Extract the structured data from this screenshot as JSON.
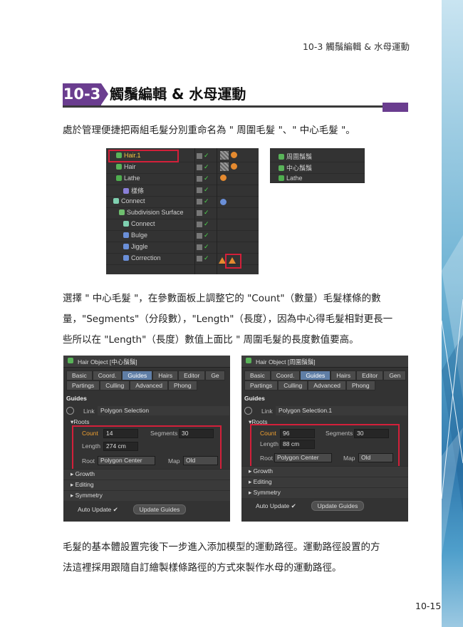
{
  "header": "10-3 觸鬚編輯 & 水母運動",
  "title": {
    "chapter": "10-3",
    "text": "觸鬚編輯 & 水母運動"
  },
  "para1": "處於管理便捷把兩組毛髮分別重命名為 \" 周圍毛髮 \"、\" 中心毛髮 \"。",
  "object_manager": {
    "rows": [
      "Hair.1",
      "Hair",
      "Lathe",
      "樣條",
      "Connect",
      "Subdivision Surface",
      "Connect",
      "Bulge",
      "Jiggle",
      "Correction"
    ]
  },
  "object_manager_small": {
    "rows": [
      "周圍鬚鬚",
      "中心鬚鬚",
      "Lathe"
    ]
  },
  "para2": [
    "選擇 \" 中心毛髮 \"，在參數面板上調整它的 \"Count\"（數量）毛髮樣條的數",
    "量，\"Segments\"（分段數），\"Length\"（長度），因為中心得毛髮相對更長一",
    "些所以在 \"Length\"（長度）數值上面比 \" 周圍毛髮的長度數值要高。"
  ],
  "panel_left": {
    "title": "Hair Object [中心鬚鬚]",
    "tabs_row1": [
      "Basic",
      "Coord.",
      "Guides",
      "Hairs",
      "Editor",
      "Ge"
    ],
    "tabs_row2": [
      "Partings",
      "Culling",
      "Advanced",
      "Phong"
    ],
    "section": "Guides",
    "link_label": "Link",
    "link_value": "Polygon Selection",
    "roots": "▾Roots",
    "count_label": "Count",
    "count_value": "14",
    "segments_label": "Segments",
    "segments_value": "30",
    "length_label": "Length",
    "length_value": "274 cm",
    "root_label": "Root",
    "root_value": "Polygon Center",
    "map_label": "Map",
    "map_value": "Old",
    "growth": "Growth",
    "editing": "Editing",
    "symmetry": "Symmetry",
    "auto_update": "Auto Update ✔",
    "update_guides": "Update Guides"
  },
  "panel_right": {
    "title": "Hair Object [周圍鬚鬚]",
    "tabs_row1": [
      "Basic",
      "Coord.",
      "Guides",
      "Hairs",
      "Editor",
      "Gen"
    ],
    "tabs_row2": [
      "Partings",
      "Culling",
      "Advanced",
      "Phong"
    ],
    "section": "Guides",
    "link_label": "Link",
    "link_value": "Polygon Selection.1",
    "roots": "▾Roots",
    "count_label": "Count",
    "count_value": "96",
    "segments_label": "Segments",
    "segments_value": "30",
    "length_label": "Length",
    "length_value": "88 cm",
    "root_label": "Root",
    "root_value": "Polygon Center",
    "map_label": "Map",
    "map_value": "Old",
    "growth": "Growth",
    "editing": "Editing",
    "symmetry": "Symmetry",
    "auto_update": "Auto Update ✔",
    "update_guides": "Update Guides"
  },
  "para3": [
    "毛髮的基本體設置完後下一步進入添加模型的運動路徑。運動路徑設置的方",
    "法這裡採用跟隨自訂繪製樣條路徑的方式來製作水母的運動路徑。"
  ],
  "page_number": "10-15",
  "colors": {
    "accent": "#6a3d8f",
    "highlight": "#d3203a"
  }
}
